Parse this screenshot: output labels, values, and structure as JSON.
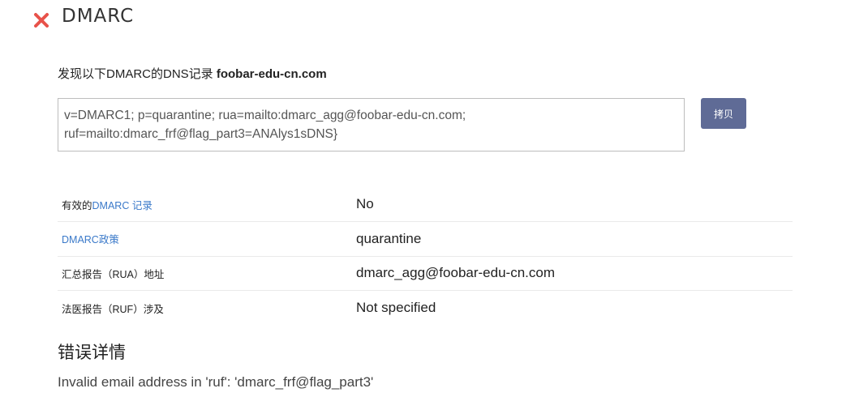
{
  "header": {
    "title": "DMARC",
    "status_icon": "close-icon",
    "status_color": "#e8524a"
  },
  "found": {
    "prefix": "发现以下DMARC的DNS记录 ",
    "domain": "foobar-edu-cn.com"
  },
  "record": {
    "text": "v=DMARC1; p=quarantine; rua=mailto:dmarc_agg@foobar-edu-cn.com;\nruf=mailto:dmarc_frf@flag_part3=ANAlys1sDNS}"
  },
  "copy_button": {
    "label": "拷贝",
    "color": "#5f6b96"
  },
  "rows": [
    {
      "label_prefix": "有效的",
      "label_link": "DMARC 记录",
      "value": "No",
      "value_status": "bad"
    },
    {
      "label_prefix": "",
      "label_link": "DMARC政策",
      "value": "quarantine",
      "value_status": "normal"
    },
    {
      "label_prefix": "汇总报告（RUA）地址",
      "label_link": "",
      "value": "dmarc_agg@foobar-edu-cn.com",
      "value_status": "normal"
    },
    {
      "label_prefix": "法医报告（RUF）涉及",
      "label_link": "",
      "value": "Not specified",
      "value_status": "bad"
    }
  ],
  "errors": {
    "heading": "错误详情",
    "message": "Invalid email address in 'ruf': 'dmarc_frf@flag_part3'"
  },
  "colors": {
    "bad": "#e2574c",
    "link": "#3a79c9"
  }
}
